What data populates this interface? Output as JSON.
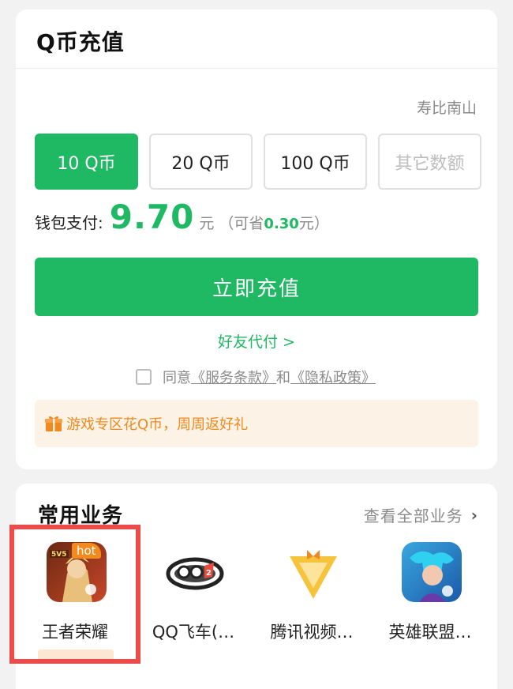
{
  "recharge_card": {
    "title": "Q币充值",
    "account_name": "寿比南山",
    "amount_options": [
      {
        "label": "10 Q币",
        "selected": true
      },
      {
        "label": "20 Q币",
        "selected": false
      },
      {
        "label": "100 Q币",
        "selected": false
      },
      {
        "label": "其它数额",
        "selected": false
      }
    ],
    "pay_label": "钱包支付:",
    "pay_amount": "9.70",
    "pay_unit": "元",
    "save_prefix": "（可省",
    "save_amount": "0.30",
    "save_suffix": "元）",
    "recharge_button": "立即充值",
    "friend_pay": "好友代付 >",
    "agree_prefix": "同意",
    "terms_link": "《服务条款》",
    "agree_and": "和",
    "privacy_link": "《隐私政策》",
    "promo_text": "游戏专区花Q币，周周返好礼",
    "brand_color": "#1fb863",
    "promo_color": "#f08a1e"
  },
  "services_card": {
    "title": "常用业务",
    "view_all": "查看全部业务",
    "items": [
      {
        "label": "王者荣耀",
        "icon": "honor-of-kings-icon",
        "badge": "hot"
      },
      {
        "label": "QQ飞车(…",
        "icon": "qq-speed-icon"
      },
      {
        "label": "腾讯视频…",
        "icon": "tencent-video-icon"
      },
      {
        "label": "英雄联盟…",
        "icon": "league-of-legends-icon"
      }
    ],
    "highlight_color": "#ec4b4b"
  }
}
